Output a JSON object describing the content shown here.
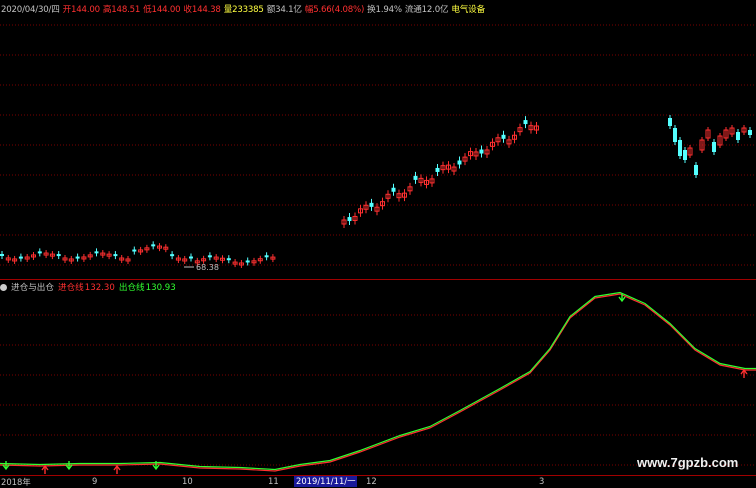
{
  "header": {
    "date": "2020/04/30/四",
    "open": "开144.00",
    "high": "高148.51",
    "low": "低144.00",
    "close": "收144.38",
    "volume": "量233385",
    "amount": "额34.1亿",
    "change": "幅5.66(4.08%)",
    "turnover": "换1.94%",
    "float_cap": "流通12.0亿",
    "sector": "电气设备"
  },
  "main_chart": {
    "min_label": "68.38",
    "colors": {
      "up": "#ff3030",
      "down": "#54ffff",
      "grid": "#7a0000",
      "text": "#c0c0c0"
    }
  },
  "indicator": {
    "name": "进仓与出仓",
    "entry_label": "进仓线",
    "entry_value": "132.30",
    "exit_label": "出仓线",
    "exit_value": "130.93",
    "colors": {
      "entry": "#ff3030",
      "exit": "#30ff30"
    }
  },
  "date_axis": {
    "labels": [
      "2018年",
      "9",
      "10",
      "11",
      "12",
      "3"
    ],
    "cursor": "2019/11/11/一"
  },
  "watermark": "www.7gpzb.com"
}
